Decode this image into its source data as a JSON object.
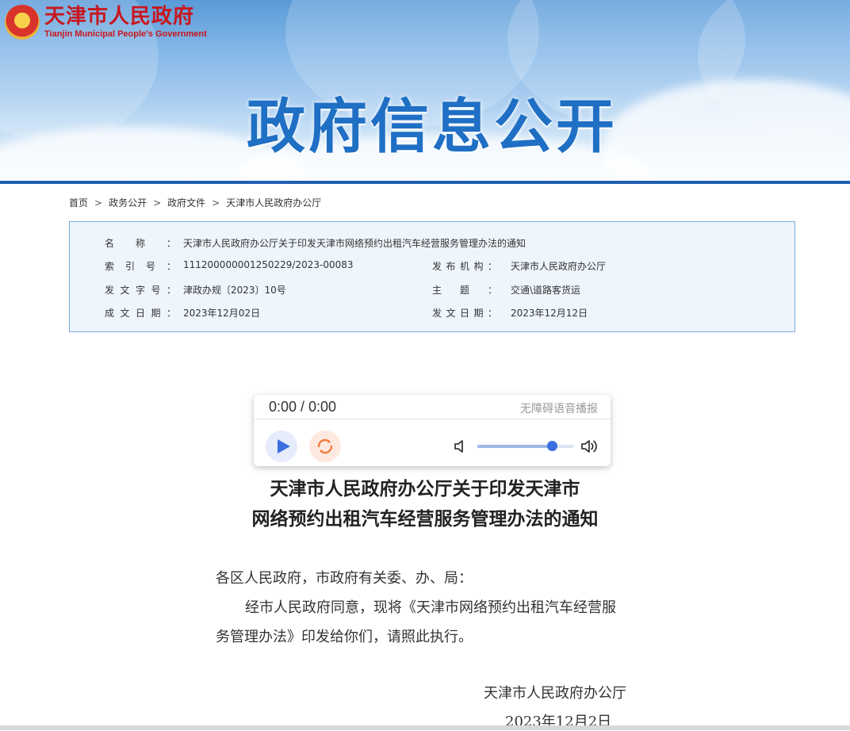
{
  "header": {
    "logo_cn": "天津市人民政府",
    "logo_en": "Tianjin Municipal People's Government",
    "banner_title": "政府信息公开"
  },
  "breadcrumb": [
    "首页",
    "政务公开",
    "政府文件",
    "天津市人民政府办公厅"
  ],
  "metadata": {
    "name_label": "名称：",
    "name_value": "天津市人民政府办公厅关于印发天津市网络预约出租汽车经营服务管理办法的通知",
    "index_label": "索引号：",
    "index_value": "11120000000125022​9/2023-00083",
    "publisher_label": "发布机构：",
    "publisher_value": "天津市人民政府办公厅",
    "docno_label": "发文字号：",
    "docno_value": "津政办规〔2023〕10号",
    "subject_label": "主题：",
    "subject_value": "交通\\道路客货运",
    "created_label": "成文日期：",
    "created_value": "2023年12月02日",
    "issued_label": "发文日期：",
    "issued_value": "2023年12月12日"
  },
  "player": {
    "time": "0:00 / 0:00",
    "label": "无障碍语音播报",
    "volume": 0.77,
    "icons": [
      "play-icon",
      "loop-icon",
      "volume-low-icon",
      "volume-high-icon"
    ]
  },
  "document": {
    "title_line1": "天津市人民政府办公厅关于印发天津市",
    "title_line2": "网络预约出租汽车经营服务管理办法的通知",
    "salutation": "各区人民政府，市政府有关委、办、局：",
    "para1_line1": "经市人民政府同意，现将《天津市网络预约出租汽车经营服",
    "para1_line2": "务管理办法》印发给你们，请照此执行。",
    "signature": "天津市人民政府办公厅",
    "date": "2023年12月2日"
  }
}
